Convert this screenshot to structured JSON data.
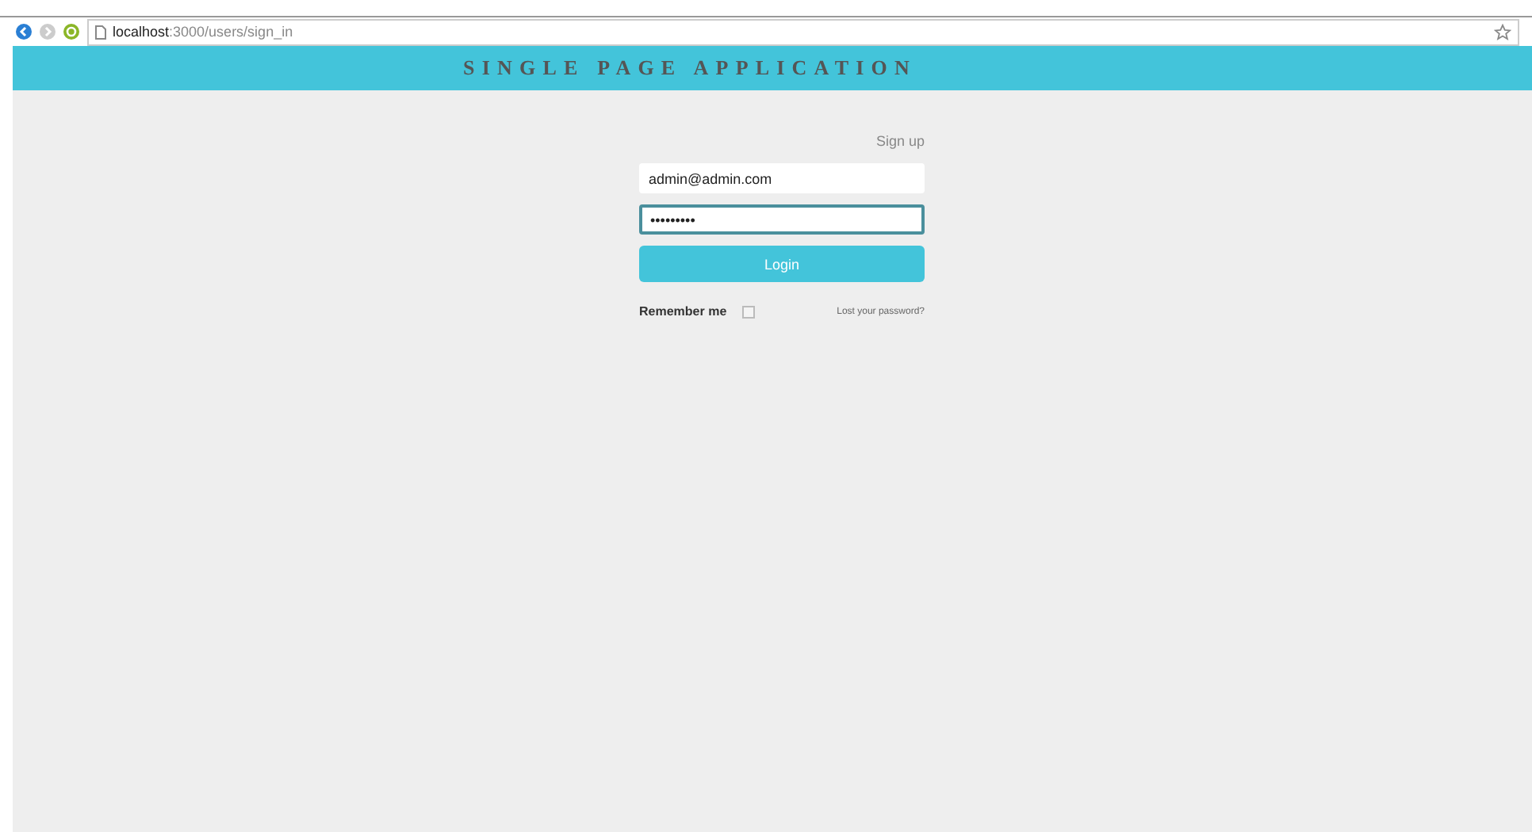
{
  "browser": {
    "url_host": "localhost",
    "url_path": ":3000/users/sign_in"
  },
  "header": {
    "title": "SINGLE PAGE APPLICATION"
  },
  "form": {
    "signup_link": "Sign up",
    "email": "admin@admin.com",
    "password": "•••••••••",
    "password_focused": true,
    "login_button": "Login",
    "remember_label": "Remember me",
    "remember_checked": false,
    "lost_password_link": "Lost your password?"
  }
}
